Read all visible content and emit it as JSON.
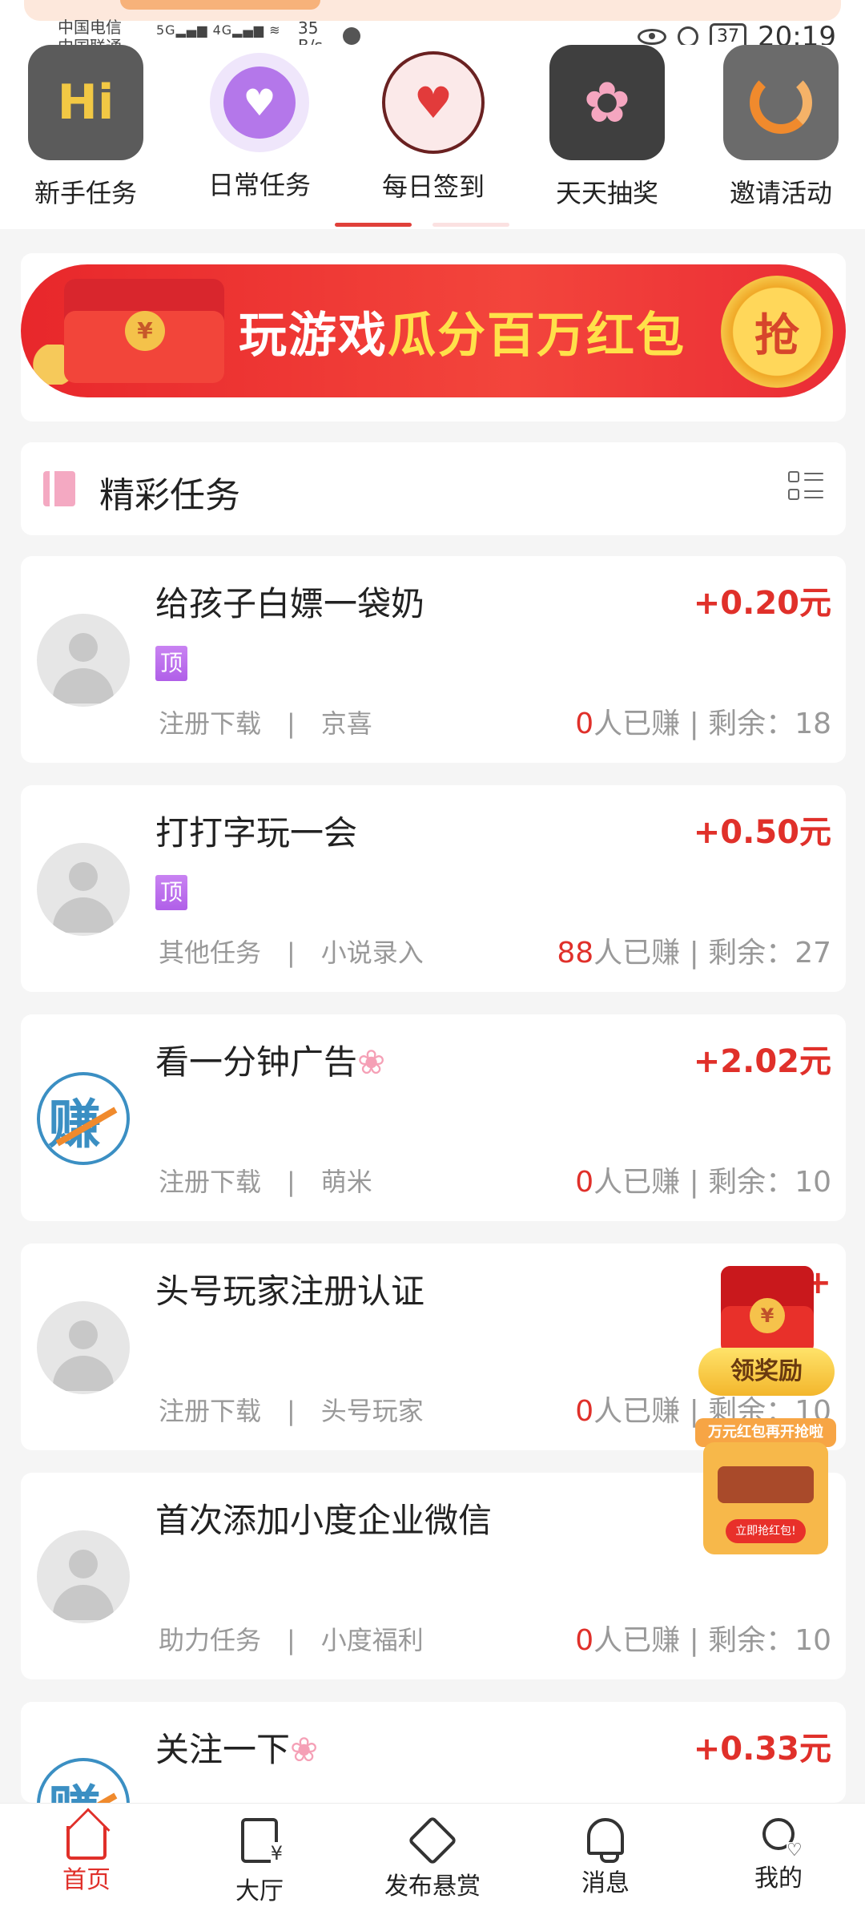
{
  "status_bar": {
    "carrier1": "中国电信",
    "carrier2": "中国联通",
    "speed_value": "35",
    "speed_unit": "B/s",
    "battery": "37",
    "time": "20:19"
  },
  "quick_actions": [
    {
      "label": "新手任务",
      "icon": "hi-icon"
    },
    {
      "label": "日常任务",
      "icon": "heart-icon"
    },
    {
      "label": "每日签到",
      "icon": "heart-plant-icon"
    },
    {
      "label": "天天抽奖",
      "icon": "pinwheel-icon"
    },
    {
      "label": "邀请活动",
      "icon": "ring-icon"
    }
  ],
  "banner": {
    "text_prefix": "玩游戏",
    "text_highlight": "瓜分百万红包",
    "grab_label": "抢",
    "coin_symbol": "¥"
  },
  "section": {
    "title": "精彩任务"
  },
  "tasks": [
    {
      "title": "给孩子白嫖一袋奶",
      "badge": "顶",
      "price": "+0.20元",
      "category": "注册下载",
      "merchant": "京喜",
      "earned": "0",
      "earned_suffix": "人已赚",
      "remain_label": "剩余：",
      "remain": "18"
    },
    {
      "title": "打打字玩一会",
      "badge": "顶",
      "price": "+0.50元",
      "category": "其他任务",
      "merchant": "小说录入",
      "earned": "88",
      "earned_suffix": "人已赚",
      "remain_label": "剩余：",
      "remain": "27"
    },
    {
      "title": "看一分钟广告",
      "badge": "",
      "price": "+2.02元",
      "category": "注册下载",
      "merchant": "萌米",
      "earned": "0",
      "earned_suffix": "人已赚",
      "remain_label": "剩余：",
      "remain": "10"
    },
    {
      "title": "头号玩家注册认证",
      "badge": "",
      "price": "+",
      "category": "注册下载",
      "merchant": "头号玩家",
      "earned": "0",
      "earned_suffix": "人已赚",
      "remain_label": "剩余：",
      "remain": "10"
    },
    {
      "title": "首次添加小度企业微信",
      "badge": "",
      "price": "+",
      "category": "助力任务",
      "merchant": "小度福利",
      "earned": "0",
      "earned_suffix": "人已赚",
      "remain_label": "剩余：",
      "remain": "10"
    },
    {
      "title": "关注一下",
      "badge": "",
      "price": "+0.33元",
      "category": "",
      "merchant": "",
      "earned": "",
      "earned_suffix": "",
      "remain_label": "",
      "remain": ""
    }
  ],
  "float": {
    "reward_label": "领奖励",
    "machine_top": "万元红包再开抢啦",
    "machine_btn": "立即抢红包!"
  },
  "bottom_nav": [
    {
      "label": "首页",
      "active": true
    },
    {
      "label": "大厅"
    },
    {
      "label": "发布悬赏"
    },
    {
      "label": "消息"
    },
    {
      "label": "我的"
    }
  ],
  "colors": {
    "accent": "#e0302a",
    "badge_purple": "#b05fe8"
  }
}
